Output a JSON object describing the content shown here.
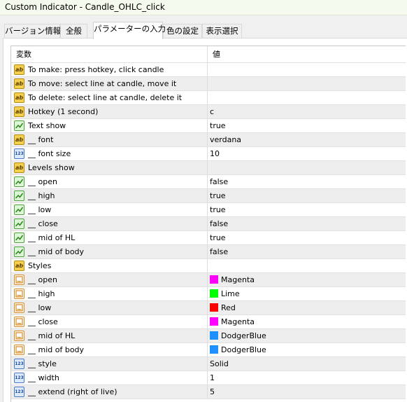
{
  "window": {
    "title": "Custom Indicator - Candle_OHLC_click"
  },
  "tabs": [
    {
      "label": "バージョン情報"
    },
    {
      "label": "全般"
    },
    {
      "label": "パラメーターの入力"
    },
    {
      "label": "色の設定"
    },
    {
      "label": "表示選択"
    }
  ],
  "grid": {
    "headers": {
      "name": "変数",
      "value": "値"
    },
    "rows": [
      {
        "type": "ab",
        "name": "To make: press hotkey, click candle",
        "value": ""
      },
      {
        "type": "ab",
        "name": "To move: select line at candle, move it",
        "value": ""
      },
      {
        "type": "ab",
        "name": "To delete: select line at candle, delete it",
        "value": ""
      },
      {
        "type": "ab",
        "name": "Hotkey (1 second)",
        "value": "c"
      },
      {
        "type": "bool",
        "name": "Text show",
        "value": "true"
      },
      {
        "type": "ab",
        "name": "__ font",
        "value": "verdana"
      },
      {
        "type": "num",
        "name": "__ font size",
        "value": "10"
      },
      {
        "type": "ab",
        "name": "Levels show",
        "value": ""
      },
      {
        "type": "bool",
        "name": "__ open",
        "value": "false"
      },
      {
        "type": "bool",
        "name": "__ high",
        "value": "true"
      },
      {
        "type": "bool",
        "name": "__ low",
        "value": "true"
      },
      {
        "type": "bool",
        "name": "__ close",
        "value": "false"
      },
      {
        "type": "bool",
        "name": "__ mid of HL",
        "value": "true"
      },
      {
        "type": "bool",
        "name": "__ mid of body",
        "value": "false"
      },
      {
        "type": "ab",
        "name": "Styles",
        "value": ""
      },
      {
        "type": "color",
        "name": "__ open",
        "value": "Magenta",
        "swatch": "#ff00ff"
      },
      {
        "type": "color",
        "name": "__ high",
        "value": "Lime",
        "swatch": "#00ff00"
      },
      {
        "type": "color",
        "name": "__ low",
        "value": "Red",
        "swatch": "#ff0000"
      },
      {
        "type": "color",
        "name": "__ close",
        "value": "Magenta",
        "swatch": "#ff00ff"
      },
      {
        "type": "color",
        "name": "__ mid of HL",
        "value": "DodgerBlue",
        "swatch": "#1e90ff"
      },
      {
        "type": "color",
        "name": "__ mid of body",
        "value": "DodgerBlue",
        "swatch": "#1e90ff"
      },
      {
        "type": "num",
        "name": "__ style",
        "value": "Solid"
      },
      {
        "type": "num",
        "name": "__ width",
        "value": "1"
      },
      {
        "type": "num",
        "name": "__ extend (right of live)",
        "value": "5"
      }
    ]
  }
}
